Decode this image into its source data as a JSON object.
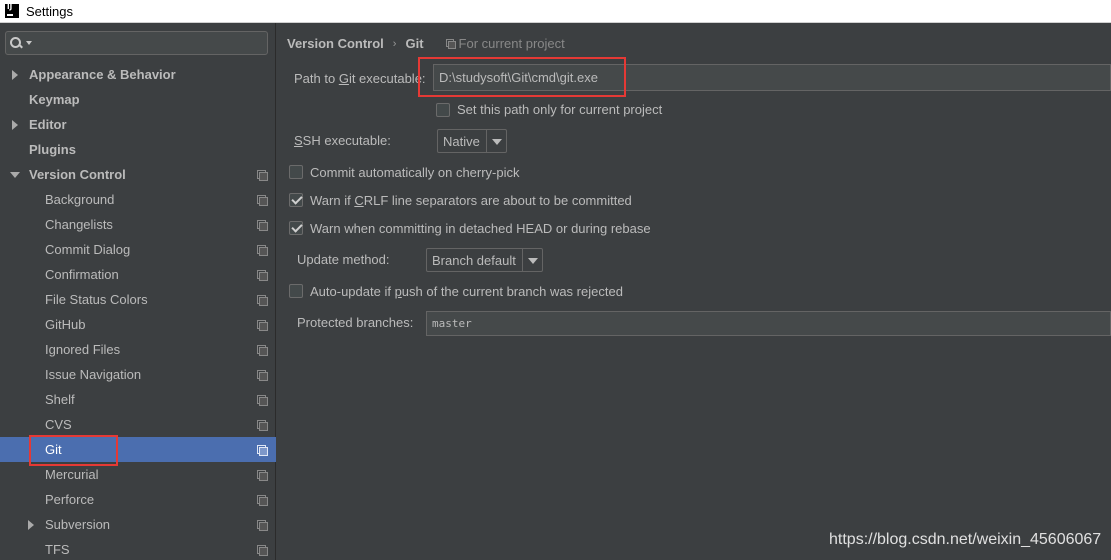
{
  "window": {
    "title": "Settings"
  },
  "search": {
    "value": "",
    "placeholder": ""
  },
  "sidebar": {
    "items": [
      {
        "label": "Appearance & Behavior",
        "level": "top",
        "expandable": true,
        "expanded": false
      },
      {
        "label": "Keymap",
        "level": "top",
        "expandable": false
      },
      {
        "label": "Editor",
        "level": "top",
        "expandable": true,
        "expanded": false
      },
      {
        "label": "Plugins",
        "level": "top",
        "expandable": false
      },
      {
        "label": "Version Control",
        "level": "top",
        "expandable": true,
        "expanded": true
      },
      {
        "label": "Background",
        "level": "child"
      },
      {
        "label": "Changelists",
        "level": "child"
      },
      {
        "label": "Commit Dialog",
        "level": "child"
      },
      {
        "label": "Confirmation",
        "level": "child"
      },
      {
        "label": "File Status Colors",
        "level": "child"
      },
      {
        "label": "GitHub",
        "level": "child"
      },
      {
        "label": "Ignored Files",
        "level": "child"
      },
      {
        "label": "Issue Navigation",
        "level": "child"
      },
      {
        "label": "Shelf",
        "level": "child"
      },
      {
        "label": "CVS",
        "level": "child"
      },
      {
        "label": "Git",
        "level": "child",
        "selected": true
      },
      {
        "label": "Mercurial",
        "level": "child"
      },
      {
        "label": "Perforce",
        "level": "child"
      },
      {
        "label": "Subversion",
        "level": "child",
        "expandable": true
      },
      {
        "label": "TFS",
        "level": "child"
      }
    ]
  },
  "breadcrumb": {
    "parent": "Version Control",
    "separator": "›",
    "current": "Git",
    "note": "For current project"
  },
  "git": {
    "path_label_pre": "Path to ",
    "path_label_mnemonic": "G",
    "path_label_post": "it executable:",
    "path_value": "D:\\studysoft\\Git\\cmd\\git.exe",
    "set_path_only_label": "Set this path only for current project",
    "set_path_only_checked": false,
    "ssh_label_mnemonic": "S",
    "ssh_label_post": "SH executable:",
    "ssh_value": "Native",
    "commit_cherry_pick_label": "Commit automatically on cherry-pick",
    "commit_cherry_pick_checked": false,
    "warn_crlf_pre": "Warn if ",
    "warn_crlf_mnemonic": "C",
    "warn_crlf_post": "RLF line separators are about to be committed",
    "warn_crlf_checked": true,
    "warn_detached_label": "Warn when committing in detached HEAD or during rebase",
    "warn_detached_checked": true,
    "update_method_label": "Update method:",
    "update_method_value": "Branch default",
    "auto_update_pre": "Auto-update if ",
    "auto_update_mnemonic": "p",
    "auto_update_post": "ush of the current branch was rejected",
    "auto_update_checked": false,
    "protected_branches_label": "Protected branches:",
    "protected_branches_value": "master"
  },
  "watermark": "https://blog.csdn.net/weixin_45606067",
  "colors": {
    "background": "#3c3f41",
    "selection": "#4b6eaf",
    "highlight_box": "#e53935",
    "text": "#bbbbbb"
  }
}
